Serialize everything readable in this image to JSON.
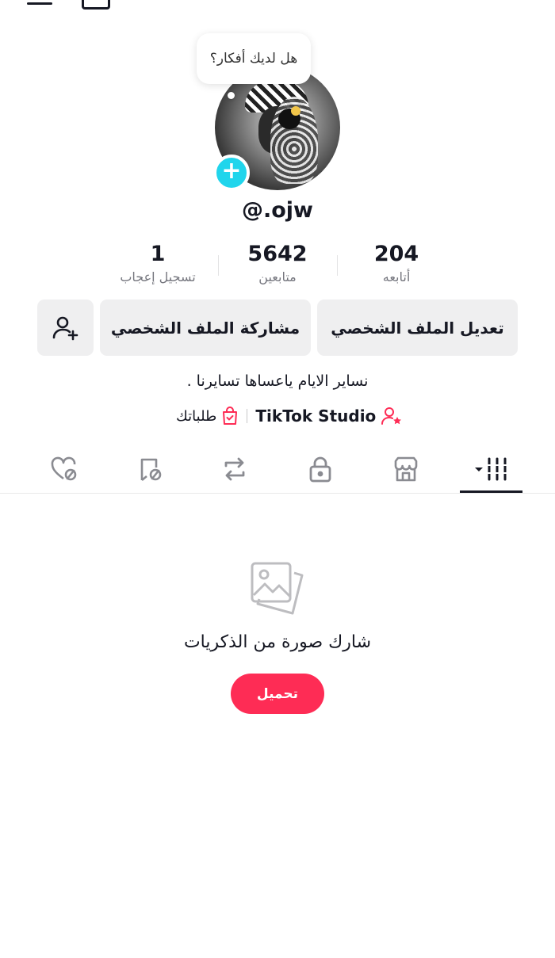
{
  "profile": {
    "username": "@.ojw",
    "bubble_text": "هل لديك أفكار؟",
    "bio": "نساير الايام ياعساها تسايرنا ."
  },
  "stats": [
    {
      "value": "204",
      "label": "أتابعه"
    },
    {
      "value": "5642",
      "label": "متابعين"
    },
    {
      "value": "1",
      "label": "تسجيل إعجاب"
    }
  ],
  "buttons": {
    "edit_profile": "تعديل الملف الشخصي",
    "share_profile": "مشاركة الملف الشخصي"
  },
  "links": {
    "studio": "TikTok Studio",
    "orders": "طلباتك"
  },
  "tabs": [
    {
      "icon": "videos-grid-icon",
      "active": true
    },
    {
      "icon": "shop-icon",
      "active": false
    },
    {
      "icon": "lock-icon",
      "active": false
    },
    {
      "icon": "repost-icon",
      "active": false
    },
    {
      "icon": "favorites-hidden-icon",
      "active": false
    },
    {
      "icon": "liked-hidden-icon",
      "active": false
    }
  ],
  "empty_state": {
    "title": "شارك صورة من الذكريات",
    "upload_label": "تحميل"
  },
  "colors": {
    "accent": "#fe2c55",
    "badge": "#20d5ec",
    "button_bg": "#efeff0"
  }
}
